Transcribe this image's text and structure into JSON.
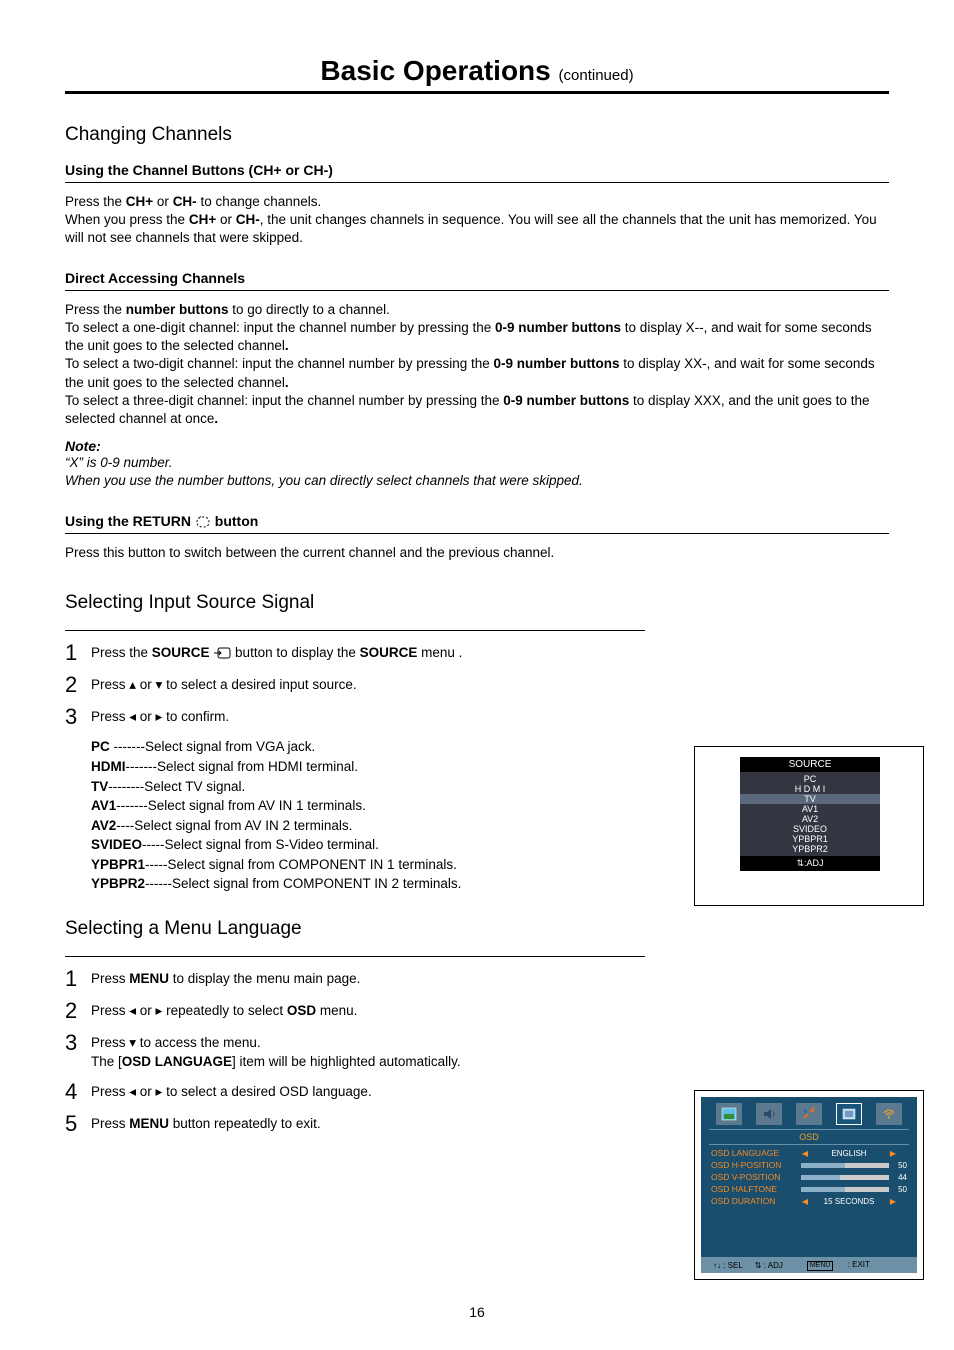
{
  "title": {
    "main": "Basic Operations ",
    "cont": "(continued)"
  },
  "s1": {
    "heading": "Changing Channels",
    "sub1": "Using the Channel Buttons (CH+ or CH-)",
    "p1": "Press the CH+ or CH-  to change channels.",
    "p2": "When you press the CH+ or CH-, the unit changes channels in sequence. You will see all the channels that the unit has memorized. You will not see channels that were skipped.",
    "sub2": "Direct Accessing Channels",
    "da1": "Press the number buttons to go directly to a channel.",
    "da2": "To select a one-digit channel: input the channel number  by pressing the 0-9 number buttons to display X--,  and wait for some seconds  the unit goes to the selected channel.",
    "da3": "To select a two-digit channel: input the channel number  by pressing the 0-9 number buttons to display XX-,  and wait for some seconds  the unit goes to the selected channel.",
    "da4": "To select a three-digit channel: input the channel number  by pressing the 0-9 number buttons to display XXX,  and the unit goes to the selected channel at once.",
    "note_label": "Note:",
    "note1": "“X” is 0-9 number.",
    "note2": "When you use the number buttons, you can directly select channels  that  were  skipped.",
    "sub3_pre": "Using the RETURN ",
    "sub3_post": " button",
    "return_p": "Press this button to switch between the current channel and the  previous channel."
  },
  "s2": {
    "heading": "Selecting Input Source Signal",
    "step1_pre": "Press the  ",
    "step1_b1": "SOURCE ",
    "step1_mid": " button to display the ",
    "step1_b2": "SOURCE",
    "step1_post": " menu .",
    "step2": "Press  ▴ or ▾  to select a desired input source.",
    "step3": "Press  ◂  or  ▸  to confirm.",
    "signals": [
      {
        "k": "PC",
        "d": " -------Select signal from VGA jack."
      },
      {
        "k": "HDMI",
        "d": "-------Select signal from HDMI terminal."
      },
      {
        "k": "TV",
        "d": "--------Select TV signal."
      },
      {
        "k": "AV1",
        "d": "-------Select signal from AV IN 1 terminals."
      },
      {
        "k": "AV2",
        "d": "----Select signal from AV IN 2 terminals."
      },
      {
        "k": "SVIDEO",
        "d": "-----Select signal from S-Video terminal."
      },
      {
        "k": "YPBPR1",
        "d": "-----Select signal from COMPONENT IN 1 terminals."
      },
      {
        "k": "YPBPR2",
        "d": "------Select signal from COMPONENT IN 2 terminals."
      }
    ],
    "source_menu": {
      "title": "SOURCE",
      "items": [
        "PC",
        "H D M I",
        "TV",
        "AV1",
        "AV2",
        "SVIDEO",
        "YPBPR1",
        "YPBPR2"
      ],
      "selected_index": 2,
      "footer": "⇅:ADJ"
    }
  },
  "s3": {
    "heading": "Selecting a Menu Language",
    "step1_pre": "Press  ",
    "step1_b": "MENU",
    "step1_post": " to display the menu main page.",
    "step2_pre": "Press  ◂ or ▸  repeatedly to select ",
    "step2_b": "OSD",
    "step2_post": " menu.",
    "step3_l1": "Press  ▾  to access the menu.",
    "step3_l2_pre": "The [",
    "step3_l2_b": "OSD  LANGUAGE",
    "step3_l2_post": "] item will be highlighted automatically.",
    "step4": "Press ◂ or ▸ to select a desired OSD language.",
    "step5_pre": "Press ",
    "step5_b": "MENU",
    "step5_post": "  button repeatedly to exit.",
    "osd_menu": {
      "label": "OSD",
      "rows": [
        {
          "name": "OSD LANGUAGE",
          "type": "text",
          "value": "ENGLISH"
        },
        {
          "name": "OSD H-POSITION",
          "type": "bar",
          "value": 50
        },
        {
          "name": "OSD V-POSITION",
          "type": "bar",
          "value": 44
        },
        {
          "name": "OSD HALFTONE",
          "type": "bar",
          "value": 50
        },
        {
          "name": "OSD DURATION",
          "type": "text",
          "value": "15 SECONDS"
        }
      ],
      "footer": {
        "sel": "↑↓ :  SEL",
        "adj": "⇅  :  ADJ",
        "exit_label": "MENU",
        "exit_suffix": " :   EXIT"
      }
    }
  },
  "page_number": "16"
}
